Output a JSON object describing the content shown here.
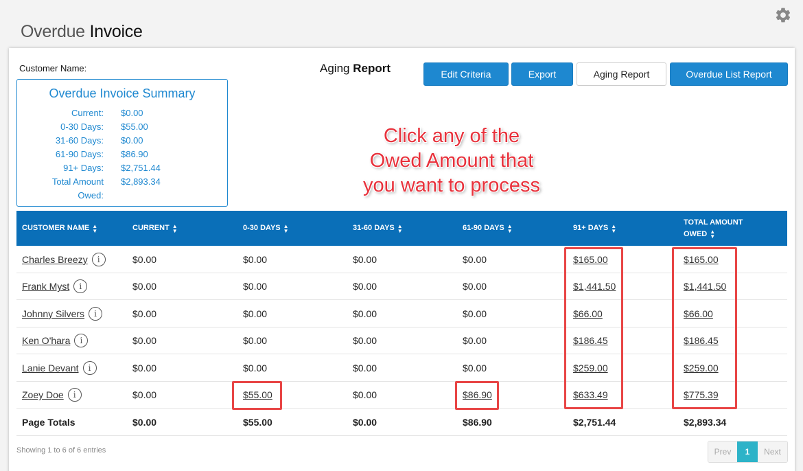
{
  "header": {
    "title_light": "Overdue",
    "title_bold": "Invoice",
    "settings_icon": "gear-icon"
  },
  "panel": {
    "customer_label": "Customer Name:",
    "report_heading_light": "Aging",
    "report_heading_bold": "Report"
  },
  "toolbar": {
    "edit_criteria": "Edit Criteria",
    "export": "Export",
    "aging_report": "Aging Report",
    "overdue_list_report": "Overdue List Report"
  },
  "summary": {
    "title": "Overdue Invoice Summary",
    "rows": [
      {
        "label": "Current:",
        "value": "$0.00"
      },
      {
        "label": "0-30 Days:",
        "value": "$55.00"
      },
      {
        "label": "31-60 Days:",
        "value": "$0.00"
      },
      {
        "label": "61-90 Days:",
        "value": "$86.90"
      },
      {
        "label": "91+ Days:",
        "value": "$2,751.44"
      },
      {
        "label": "Total Amount",
        "value": "$2,893.34"
      },
      {
        "label": "Owed:",
        "value": ""
      }
    ]
  },
  "annotation": {
    "line1": "Click any of the",
    "line2": "Owed Amount that",
    "line3": "you want to process"
  },
  "table": {
    "columns": [
      "CUSTOMER NAME",
      "CURRENT",
      "0-30 DAYS",
      "31-60 DAYS",
      "61-90 DAYS",
      "91+ DAYS",
      "TOTAL AMOUNT",
      "OWED"
    ],
    "rows": [
      {
        "name": "Charles Breezy",
        "current": "$0.00",
        "d0_30": "$0.00",
        "d31_60": "$0.00",
        "d61_90": "$0.00",
        "d91": "$165.00",
        "total": "$165.00"
      },
      {
        "name": "Frank Myst",
        "current": "$0.00",
        "d0_30": "$0.00",
        "d31_60": "$0.00",
        "d61_90": "$0.00",
        "d91": "$1,441.50",
        "total": "$1,441.50"
      },
      {
        "name": "Johnny Silvers",
        "current": "$0.00",
        "d0_30": "$0.00",
        "d31_60": "$0.00",
        "d61_90": "$0.00",
        "d91": "$66.00",
        "total": "$66.00"
      },
      {
        "name": "Ken O'hara",
        "current": "$0.00",
        "d0_30": "$0.00",
        "d31_60": "$0.00",
        "d61_90": "$0.00",
        "d91": "$186.45",
        "total": "$186.45"
      },
      {
        "name": "Lanie Devant",
        "current": "$0.00",
        "d0_30": "$0.00",
        "d31_60": "$0.00",
        "d61_90": "$0.00",
        "d91": "$259.00",
        "total": "$259.00"
      },
      {
        "name": "Zoey Doe",
        "current": "$0.00",
        "d0_30": "$55.00",
        "d31_60": "$0.00",
        "d61_90": "$86.90",
        "d91": "$633.49",
        "total": "$775.39"
      }
    ],
    "totals": {
      "label": "Page Totals",
      "current": "$0.00",
      "d0_30": "$55.00",
      "d31_60": "$0.00",
      "d61_90": "$86.90",
      "d91": "$2,751.44",
      "total": "$2,893.34"
    },
    "info_glyph": "i"
  },
  "footer": {
    "entries_text": "Showing 1 to 6 of 6 entries",
    "prev": "Prev",
    "page": "1",
    "next": "Next"
  },
  "colors": {
    "accent": "#1e88d0",
    "table_header": "#0a6fb8",
    "highlight": "#e84545",
    "annotation": "#e8323c",
    "pager_active": "#2db3c8"
  }
}
